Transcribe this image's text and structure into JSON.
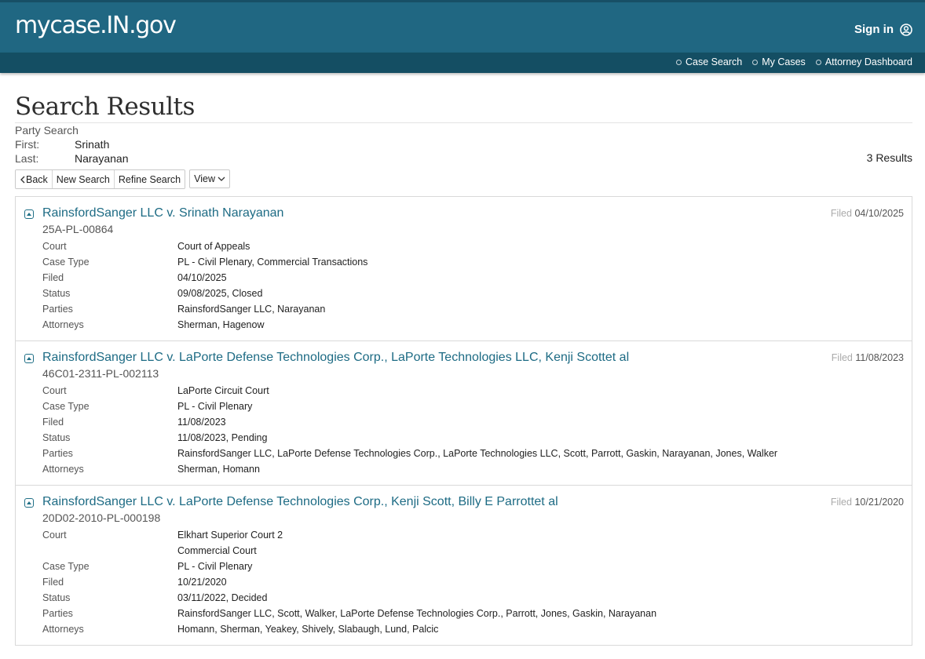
{
  "header": {
    "brand": "mycase.IN.gov",
    "signin_label": "Sign in",
    "nav": [
      "Case Search",
      "My Cases",
      "Attorney Dashboard"
    ]
  },
  "page": {
    "title": "Search Results",
    "search_kind": "Party Search",
    "first_label": "First:",
    "first_value": "Srinath",
    "last_label": "Last:",
    "last_value": "Narayanan",
    "result_count": "3 Results"
  },
  "toolbar": {
    "back": "Back",
    "new_search": "New Search",
    "refine_search": "Refine Search",
    "view": "View"
  },
  "results": [
    {
      "title": "RainsfordSanger LLC v. Srinath Narayanan",
      "case_number": "25A-PL-00864",
      "filed_label": "Filed",
      "filed_date": "04/10/2025",
      "rows": [
        {
          "label": "Court",
          "value": "Court of Appeals"
        },
        {
          "label": "Case Type",
          "value": "PL - Civil Plenary, Commercial Transactions"
        },
        {
          "label": "Filed",
          "value": "04/10/2025"
        },
        {
          "label": "Status",
          "value": "09/08/2025, Closed"
        },
        {
          "label": "Parties",
          "value": "RainsfordSanger LLC, Narayanan"
        },
        {
          "label": "Attorneys",
          "value": "Sherman, Hagenow"
        }
      ]
    },
    {
      "title": "RainsfordSanger LLC v. LaPorte Defense Technologies Corp., LaPorte Technologies LLC, Kenji Scottet al",
      "case_number": "46C01-2311-PL-002113",
      "filed_label": "Filed",
      "filed_date": "11/08/2023",
      "rows": [
        {
          "label": "Court",
          "value": "LaPorte Circuit Court"
        },
        {
          "label": "Case Type",
          "value": "PL - Civil Plenary"
        },
        {
          "label": "Filed",
          "value": "11/08/2023"
        },
        {
          "label": "Status",
          "value": "11/08/2023, Pending"
        },
        {
          "label": "Parties",
          "value": "RainsfordSanger LLC, LaPorte Defense Technologies Corp., LaPorte Technologies LLC, Scott, Parrott, Gaskin, Narayanan, Jones, Walker"
        },
        {
          "label": "Attorneys",
          "value": "Sherman, Homann"
        }
      ]
    },
    {
      "title": "RainsfordSanger LLC v. LaPorte Defense Technologies Corp., Kenji Scott, Billy E Parrottet al",
      "case_number": "20D02-2010-PL-000198",
      "filed_label": "Filed",
      "filed_date": "10/21/2020",
      "rows": [
        {
          "label": "Court",
          "value": "Elkhart Superior Court 2"
        },
        {
          "label": "",
          "value": "Commercial Court"
        },
        {
          "label": "Case Type",
          "value": "PL - Civil Plenary"
        },
        {
          "label": "Filed",
          "value": "10/21/2020"
        },
        {
          "label": "Status",
          "value": "03/11/2022, Decided"
        },
        {
          "label": "Parties",
          "value": "RainsfordSanger LLC, Scott, Walker, LaPorte Defense Technologies Corp., Parrott, Jones, Gaskin, Narayanan"
        },
        {
          "label": "Attorneys",
          "value": "Homann, Sherman, Yeakey, Shively, Slabaugh, Lund, Palcic"
        }
      ]
    }
  ]
}
